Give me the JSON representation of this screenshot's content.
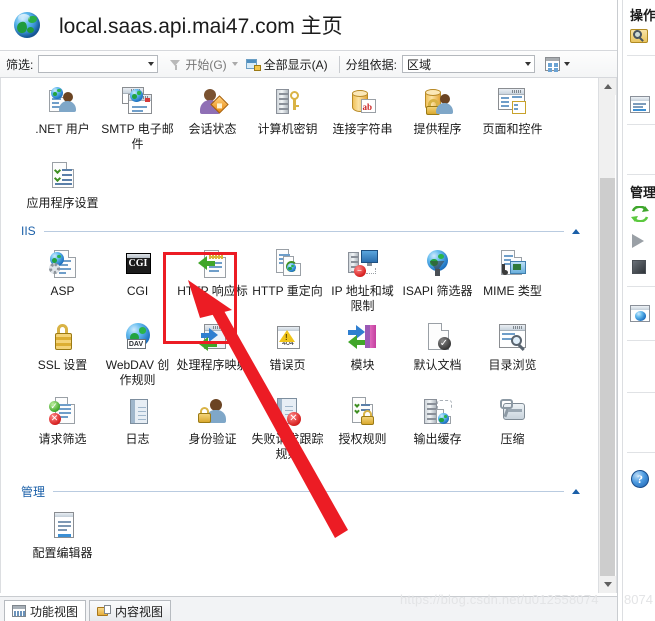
{
  "header": {
    "title": "local.saas.api.mai47.com 主页",
    "icon": "globe-icon"
  },
  "toolbar": {
    "filter_label": "筛选:",
    "filter_value": "",
    "start_label": "开始(G)",
    "start_key": "G",
    "show_all_label": "全部显示(A)",
    "show_all_key": "A",
    "group_by_label": "分组依据:",
    "group_by_value": "区域",
    "view_mode_icon": "grid-view-icon"
  },
  "sections": [
    {
      "name": "aspnet",
      "title": "",
      "items": [
        {
          "label": ".NET 用户",
          "icon": "net-users-icon"
        },
        {
          "label": "SMTP 电子邮件",
          "icon": "smtp-email-icon"
        },
        {
          "label": "会话状态",
          "icon": "session-state-icon"
        },
        {
          "label": "计算机密钥",
          "icon": "machine-key-icon"
        },
        {
          "label": "连接字符串",
          "icon": "connection-strings-icon"
        },
        {
          "label": "提供程序",
          "icon": "providers-icon"
        },
        {
          "label": "页面和控件",
          "icon": "pages-and-controls-icon"
        },
        {
          "label": "应用程序设置",
          "icon": "application-settings-icon"
        }
      ]
    },
    {
      "name": "iis",
      "title": "IIS",
      "items": [
        {
          "label": "ASP",
          "icon": "asp-icon"
        },
        {
          "label": "CGI",
          "icon": "cgi-icon"
        },
        {
          "label": "HTTP 响应标头",
          "icon": "http-response-headers-icon",
          "highlighted": true
        },
        {
          "label": "HTTP 重定向",
          "icon": "http-redirect-icon"
        },
        {
          "label": "IP 地址和域限制",
          "icon": "ip-address-domain-restrictions-icon"
        },
        {
          "label": "ISAPI 筛选器",
          "icon": "isapi-filters-icon"
        },
        {
          "label": "MIME 类型",
          "icon": "mime-types-icon"
        },
        {
          "label": "SSL 设置",
          "icon": "ssl-settings-icon"
        },
        {
          "label": "WebDAV 创作规则",
          "icon": "webdav-authoring-rules-icon"
        },
        {
          "label": "处理程序映射",
          "icon": "handler-mappings-icon"
        },
        {
          "label": "错误页",
          "icon": "error-pages-icon"
        },
        {
          "label": "模块",
          "icon": "modules-icon"
        },
        {
          "label": "默认文档",
          "icon": "default-document-icon"
        },
        {
          "label": "目录浏览",
          "icon": "directory-browsing-icon"
        },
        {
          "label": "请求筛选",
          "icon": "request-filtering-icon"
        },
        {
          "label": "日志",
          "icon": "logging-icon"
        },
        {
          "label": "身份验证",
          "icon": "authentication-icon"
        },
        {
          "label": "失败请求跟踪规则",
          "icon": "failed-request-tracing-rules-icon"
        },
        {
          "label": "授权规则",
          "icon": "authorization-rules-icon"
        },
        {
          "label": "输出缓存",
          "icon": "output-caching-icon"
        },
        {
          "label": "压缩",
          "icon": "compression-icon"
        }
      ]
    },
    {
      "name": "management",
      "title": "管理",
      "items": [
        {
          "label": "配置编辑器",
          "icon": "configuration-editor-icon"
        }
      ]
    }
  ],
  "view_tabs": [
    {
      "label": "功能视图",
      "icon": "features-view-icon",
      "active": true
    },
    {
      "label": "内容视图",
      "icon": "content-view-icon",
      "active": false
    }
  ],
  "actions_pane": {
    "title": "操作",
    "management_title": "管理",
    "items": [
      {
        "icon": "explore-icon"
      },
      {
        "icon": "basic-settings-icon"
      },
      {
        "icon": "restart-icon"
      },
      {
        "icon": "start-icon"
      },
      {
        "icon": "stop-icon"
      },
      {
        "icon": "browse-website-icon"
      },
      {
        "icon": "help-icon"
      }
    ]
  },
  "annotation": {
    "highlight_target": "HTTP 响应标头",
    "highlight_color": "#ec1c24",
    "arrow_color": "#ec1c24"
  },
  "watermark": "https://blog.csdn.net/u012558074",
  "watermark_tail": "8074"
}
